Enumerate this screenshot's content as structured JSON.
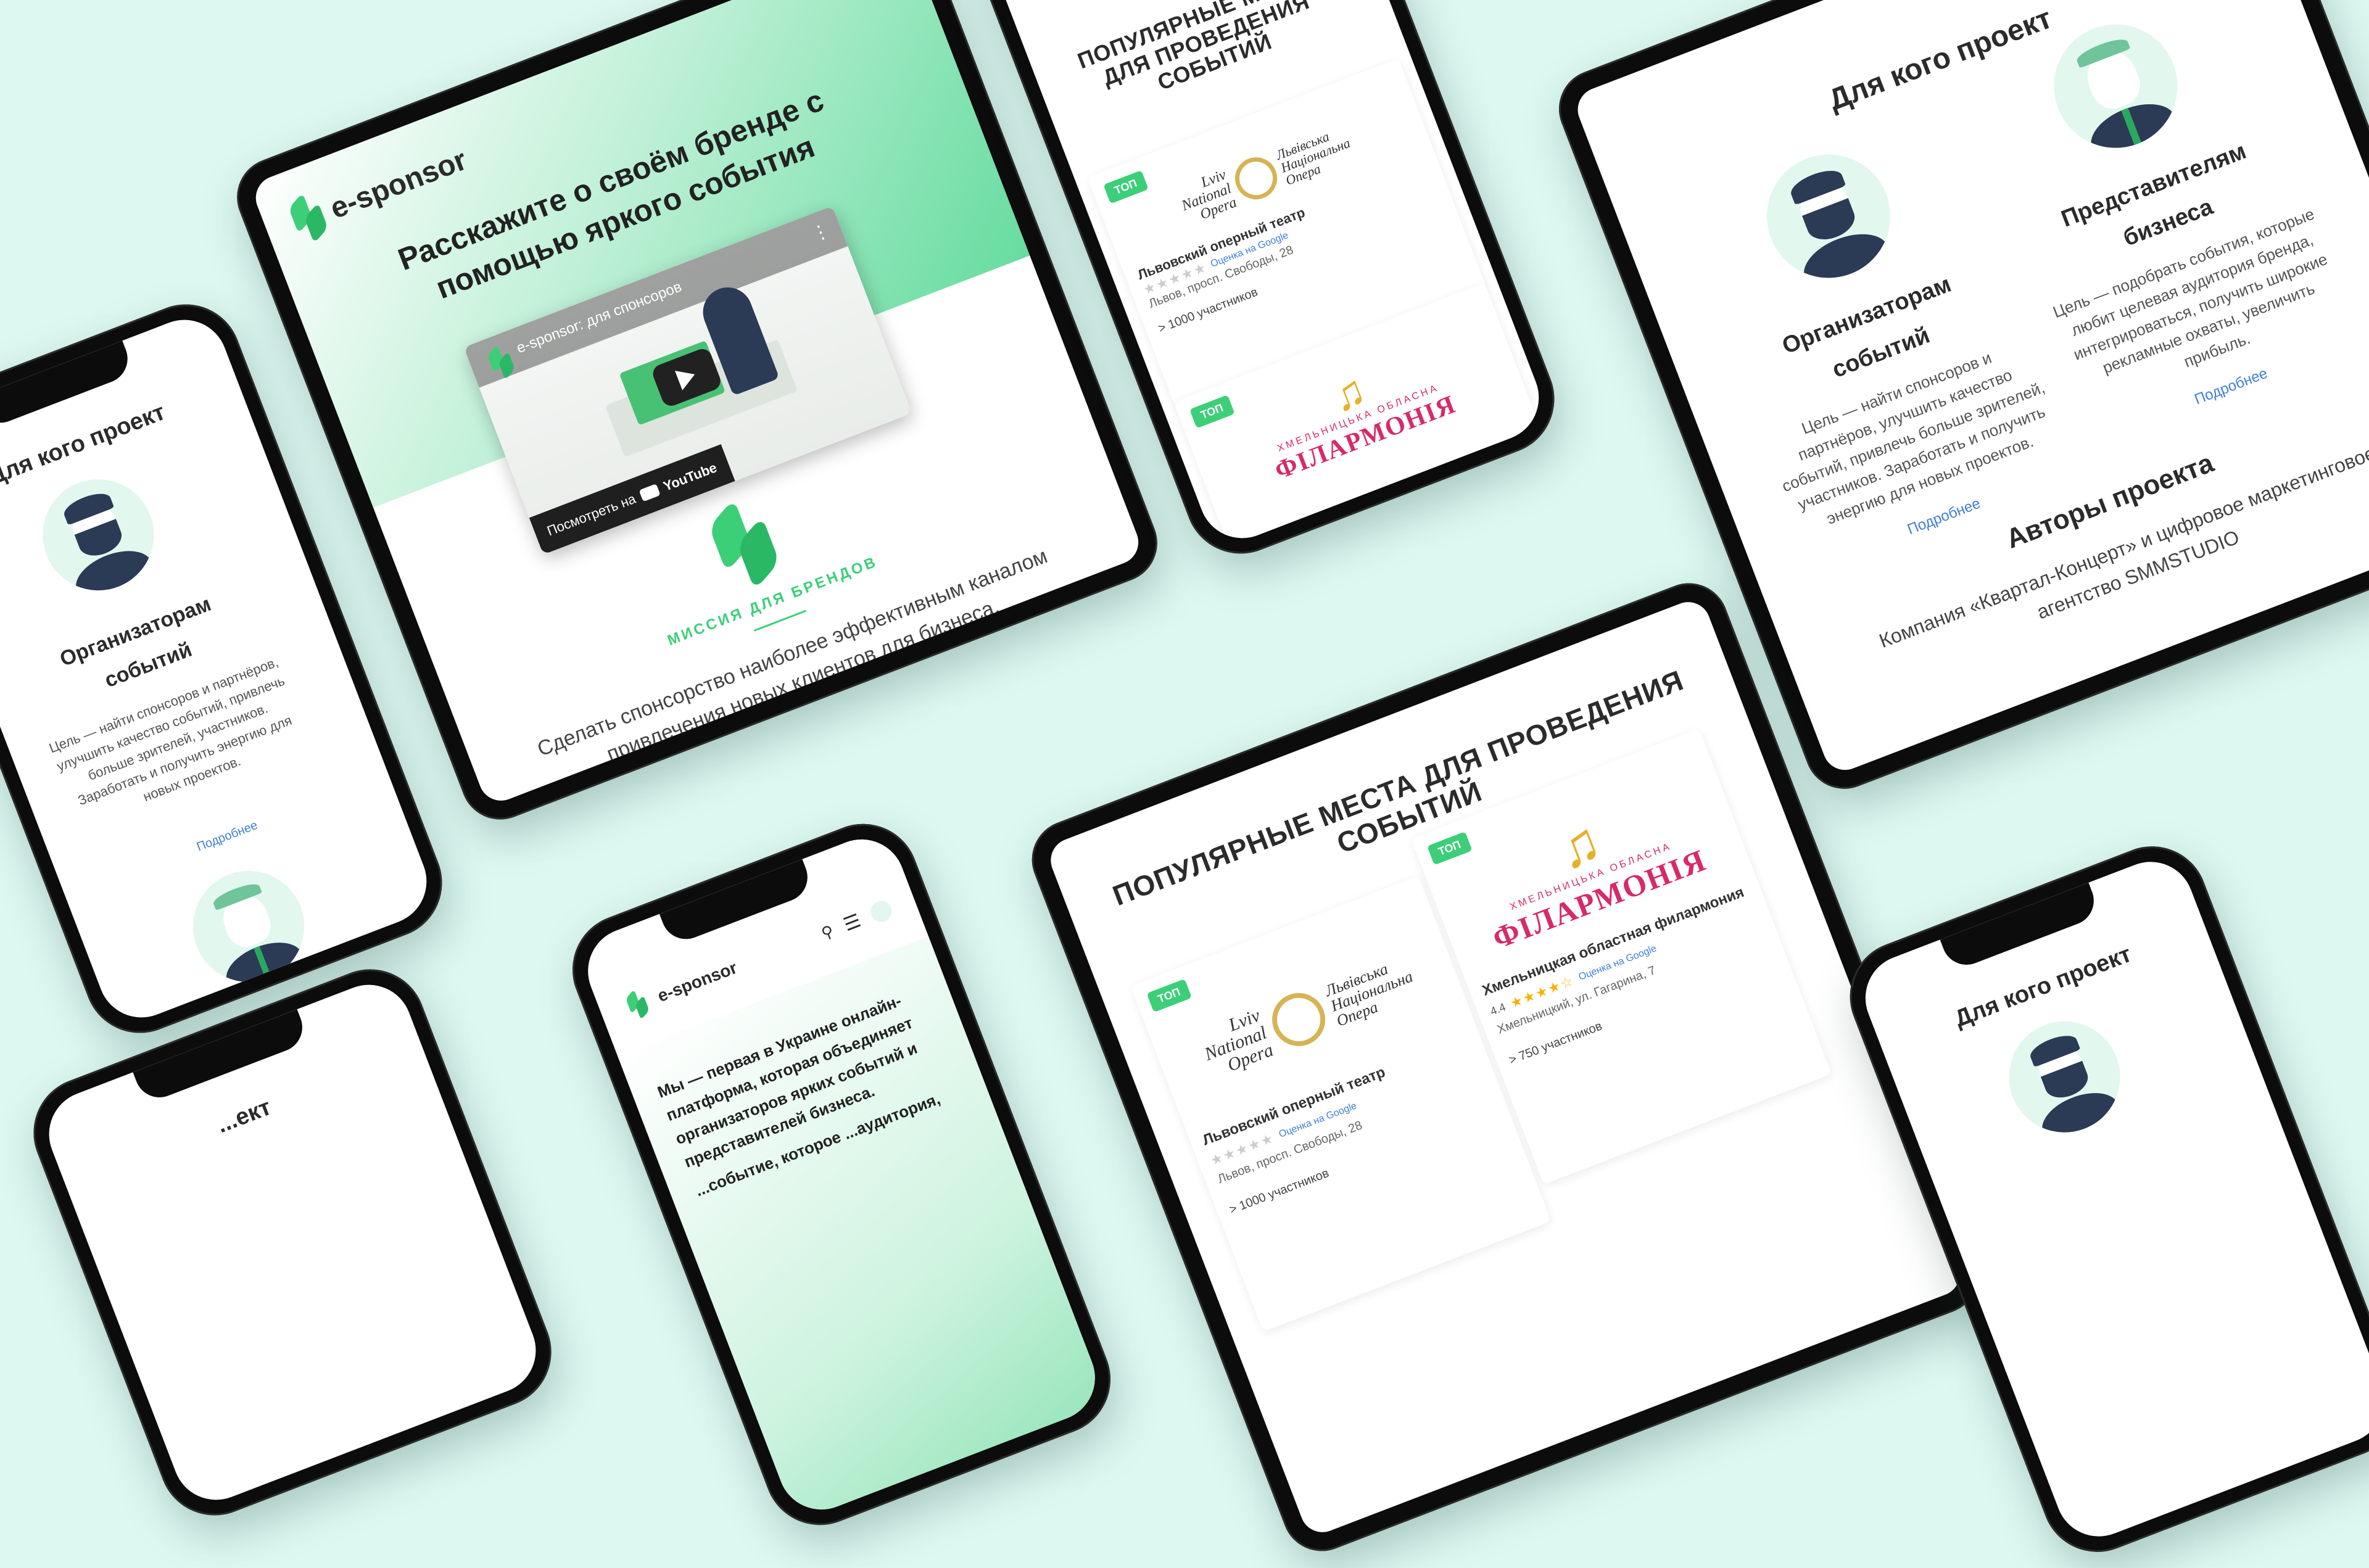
{
  "brand": {
    "name": "e-sponsor",
    "accent": "#3ccf78",
    "accent_dark": "#2bb865",
    "background": "#dcf8f1"
  },
  "hero": {
    "title": "Расскажите о своём бренде с помощью яркого события",
    "video_title": "e-sponsor: для спонсоров",
    "watch_on": "Посмотреть на",
    "youtube": "YouTube",
    "mission_label": "МИССИЯ ДЛЯ БРЕНДОВ",
    "mission_text": "Сделать спонсорство наиболее эффективным каналом привлечения новых клиентов для бизнеса."
  },
  "audience": {
    "title": "Для кого проект",
    "organizers": {
      "title": "Организаторам событий",
      "text": "Цель — найти спонсоров и партнёров, улучшить качество событий, привлечь больше зрителей, участников. Заработать и получить энергию для новых проектов.",
      "more": "Подробнее"
    },
    "business": {
      "title": "Представителям бизнеса",
      "text": "Цель — подобрать события, которые любит целевая аудитория бренда, интегрироваться, получить широкие рекламные охваты, увеличить прибыль.",
      "more": "Подробнее"
    },
    "authors_title": "Авторы проекта",
    "authors_text": "Компания «Квартал-Концерт» и цифровое маркетинговое агентство SMMSTUDIO"
  },
  "venues": {
    "title": "ПОПУЛЯРНЫЕ МЕСТА ДЛЯ ПРОВЕДЕНИЯ СОБЫТИЙ",
    "badge": "ТОП",
    "items": [
      {
        "logo_left": "Lviv National Opera",
        "logo_right": "Львівська Національна Опера",
        "name": "Львовский оперный театр",
        "rating_label": "Оценка на Google",
        "address": "Львов, просп. Свободы, 28",
        "participants": "> 1000 участников"
      },
      {
        "logo_sub": "ХМЕЛЬНИЦЬКА ОБЛАСНА",
        "logo_main": "ФІЛАРМОНІЯ",
        "name": "Хмельницкая областная филармония",
        "rating": "4.4",
        "rating_label": "Оценка на Google",
        "address": "Хмельницкий, ул. Гагарина, 7",
        "participants": "> 750 участников"
      }
    ]
  },
  "about": {
    "text_1": "Мы — первая в Украине онлайн-платформа, которая объединяет организаторов ярких событий и представителей бизнеса.",
    "text_2": "...событие, которое ...аудитория,"
  },
  "partial": {
    "title": "...ект"
  }
}
